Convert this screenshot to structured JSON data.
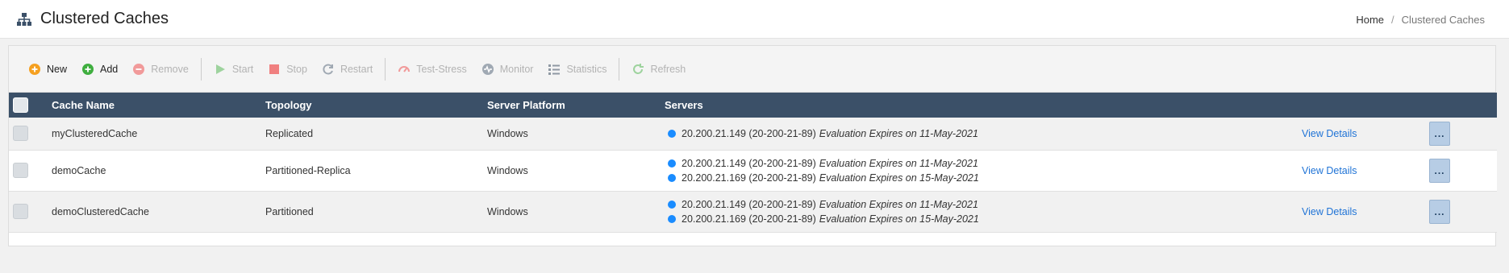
{
  "header": {
    "title": "Clustered Caches",
    "breadcrumb": {
      "home": "Home",
      "separator": "/",
      "current": "Clustered Caches"
    }
  },
  "toolbar": {
    "new": "New",
    "add": "Add",
    "remove": "Remove",
    "start": "Start",
    "stop": "Stop",
    "restart": "Restart",
    "test_stress": "Test-Stress",
    "monitor": "Monitor",
    "statistics": "Statistics",
    "refresh": "Refresh"
  },
  "table": {
    "columns": {
      "name": "Cache Name",
      "topology": "Topology",
      "platform": "Server Platform",
      "servers": "Servers"
    },
    "rows": [
      {
        "name": "myClusteredCache",
        "topology": "Replicated",
        "platform": "Windows",
        "servers": [
          {
            "text": "20.200.21.149 (20-200-21-89)",
            "note": "Evaluation Expires on 11-May-2021"
          }
        ],
        "details": "View Details",
        "more": "..."
      },
      {
        "name": "demoCache",
        "topology": "Partitioned-Replica",
        "platform": "Windows",
        "servers": [
          {
            "text": "20.200.21.149 (20-200-21-89)",
            "note": "Evaluation Expires on 11-May-2021"
          },
          {
            "text": "20.200.21.169 (20-200-21-89)",
            "note": "Evaluation Expires on 15-May-2021"
          }
        ],
        "details": "View Details",
        "more": "..."
      },
      {
        "name": "demoClusteredCache",
        "topology": "Partitioned",
        "platform": "Windows",
        "servers": [
          {
            "text": "20.200.21.149 (20-200-21-89)",
            "note": "Evaluation Expires on 11-May-2021"
          },
          {
            "text": "20.200.21.169 (20-200-21-89)",
            "note": "Evaluation Expires on 15-May-2021"
          }
        ],
        "details": "View Details",
        "more": "..."
      }
    ]
  },
  "colors": {
    "header_bg": "#3b5068",
    "link": "#1f73d6",
    "server_dot": "#1a8cff"
  }
}
